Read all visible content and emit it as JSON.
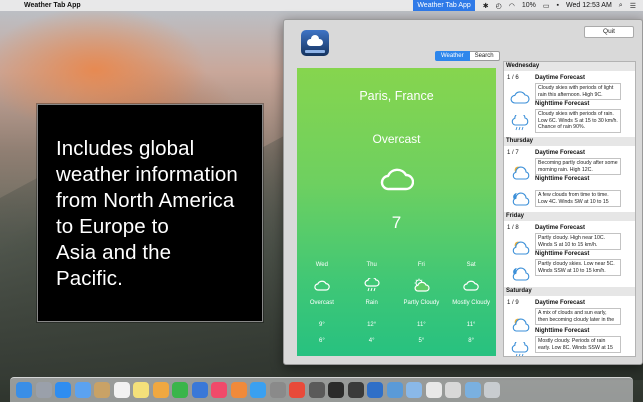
{
  "menubar": {
    "app_name": "Weather Tab App",
    "tray_title": "Weather Tab App",
    "battery": "10%",
    "datetime": "Wed 12:53 AM"
  },
  "promo": {
    "text": "Includes global\nweather information\nfrom North America\nto Europe to\nAsia and the\nPacific."
  },
  "panel": {
    "quit_label": "Quit",
    "tabs": [
      {
        "label": "Weather",
        "active": true
      },
      {
        "label": "Search",
        "active": false
      }
    ],
    "current": {
      "city": "Paris, France",
      "condition": "Overcast",
      "temperature": "7"
    },
    "days": [
      {
        "name": "Wed",
        "icon": "cloud-icon",
        "condition": "Overcast",
        "high": "9°",
        "low": "6°"
      },
      {
        "name": "Thu",
        "icon": "rain-icon",
        "condition": "Rain",
        "high": "12°",
        "low": "4°"
      },
      {
        "name": "Fri",
        "icon": "partly-cloudy-icon",
        "condition": "Partly Cloudy",
        "high": "11°",
        "low": "5°"
      },
      {
        "name": "Sat",
        "icon": "cloud-icon",
        "condition": "Mostly Cloudy",
        "high": "11°",
        "low": "8°"
      }
    ],
    "forecast": [
      {
        "day": "Wednesday",
        "date": "1 / 6",
        "daytime_title": "Daytime Forecast",
        "daytime_text": "Cloudy skies with periods of light rain this afternoon. High 9C.",
        "nighttime_title": "Nighttime Forecast",
        "nighttime_text": "Cloudy skies with periods of rain. Low 6C. Winds S at 15 to 30 km/h. Chance of rain 90%."
      },
      {
        "day": "Thursday",
        "date": "1 / 7",
        "daytime_title": "Daytime Forecast",
        "daytime_text": "Becoming partly cloudy after some morning rain. High 12C.",
        "nighttime_title": "Nighttime Forecast",
        "nighttime_text": "A few clouds from time to time. Low 4C. Winds SW at 10 to 15"
      },
      {
        "day": "Friday",
        "date": "1 / 8",
        "daytime_title": "Daytime Forecast",
        "daytime_text": "Partly cloudy. High near 10C. Winds S at 10 to 15 km/h.",
        "nighttime_title": "Nighttime Forecast",
        "nighttime_text": "Partly cloudy skies. Low near 5C. Winds SSW at 10 to 15 km/h."
      },
      {
        "day": "Saturday",
        "date": "1 / 9",
        "daytime_title": "Daytime Forecast",
        "daytime_text": "A mix of clouds and sun early, then becoming cloudy later in the",
        "nighttime_title": "Nighttime Forecast",
        "nighttime_text": "Mostly cloudy. Periods of rain early. Low 8C. Winds SSW at 15"
      }
    ]
  },
  "dock": {
    "items": [
      "finder-icon",
      "launchpad-icon",
      "safari-icon",
      "mail-icon",
      "contacts-icon",
      "calendar-icon",
      "notes-icon",
      "photos-icon",
      "numbers-icon",
      "keynote-icon",
      "music-icon",
      "books-icon",
      "appstore-icon",
      "preferences-icon",
      "chrome-icon",
      "ftp-icon",
      "terminal-icon",
      "activity-monitor-icon",
      "weather-tab-icon",
      "preview-icon",
      "folder-icon",
      "document-icon",
      "screenshot-icon",
      "downloads-icon",
      "trash-icon"
    ],
    "colors": [
      "#3a8ee6",
      "#9aa0aa",
      "#2f8df0",
      "#5ba2f0",
      "#c9a266",
      "#f2f2f2",
      "#f4e07a",
      "#f0a840",
      "#3ab54a",
      "#3a78d8",
      "#f04a6a",
      "#f08a3a",
      "#3aa0f0",
      "#8a8a8a",
      "#e84a3a",
      "#5a5a5a",
      "#2b2b2b",
      "#3a3a3a",
      "#2f6fc8",
      "#5a9ad8",
      "#8ab8e8",
      "#e8e8e8",
      "#d8d8d8",
      "#7ab0e0",
      "#c8ccd0"
    ]
  }
}
